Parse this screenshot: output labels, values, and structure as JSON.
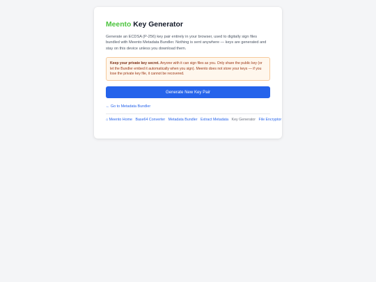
{
  "header": {
    "brand": "Meento",
    "title": "Key Generator"
  },
  "description": "Generate an ECDSA (P-256) key pair entirely in your browser, used to digitally sign files bundled with Meento Metadata Bundler. Nothing is sent anywhere — keys are generated and stay on this device unless you download them.",
  "warning": {
    "heading": "Keep your private key secret.",
    "body": "Anyone with it can sign files as you. Only share the public key (or let the Bundler embed it automatically when you sign). Meento does not store your keys — if you lose the private key file, it cannot be recovered."
  },
  "generate_button": "Generate New Key Pair",
  "back_link": "← Go to Metadata Bundler",
  "footer_nav": {
    "home": "⌂ Meento Home",
    "base64": "Base64 Converter",
    "bundler": "Metadata Bundler",
    "extract": "Extract Metadata",
    "current": "Key Generator",
    "encryptor": "File Encryptor"
  },
  "colors": {
    "brand": "#4cc43e",
    "accent": "#2563eb",
    "warning_bg": "#fff7ed",
    "warning_border": "#f6c99a",
    "warning_text": "#9a3412"
  }
}
